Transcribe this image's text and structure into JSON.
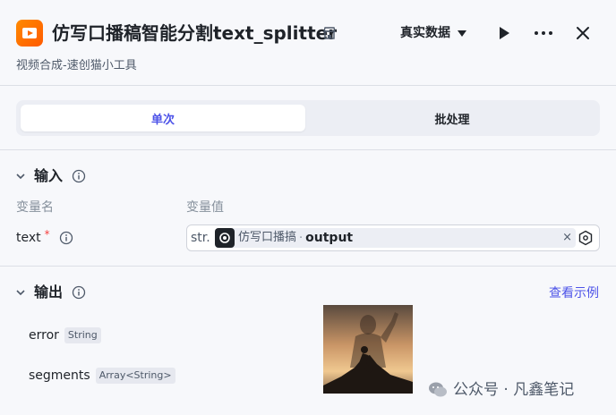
{
  "header": {
    "title": "仿写口播稿智能分割text_splitter",
    "subtitle": "视频合成-速创猫小工具",
    "data_mode": "真实数据"
  },
  "tabs": [
    {
      "label": "单次",
      "active": true
    },
    {
      "label": "批处理",
      "active": false
    }
  ],
  "input": {
    "title": "输入",
    "col_name": "变量名",
    "col_value": "变量值",
    "var_name": "text",
    "required_mark": "*",
    "type_tag": "str.",
    "ref_node": "仿写口播搞",
    "ref_sep": "·",
    "ref_output": "output",
    "clear": "×"
  },
  "output": {
    "title": "输出",
    "view_example": "查看示例",
    "fields": [
      {
        "name": "error",
        "type": "String"
      },
      {
        "name": "segments",
        "type": "Array<String>"
      }
    ]
  },
  "watermark": "公众号 · 凡鑫笔记",
  "colors": {
    "accent": "#4d53e8",
    "app_icon": "#ff6a00",
    "required": "#f53f3f"
  }
}
